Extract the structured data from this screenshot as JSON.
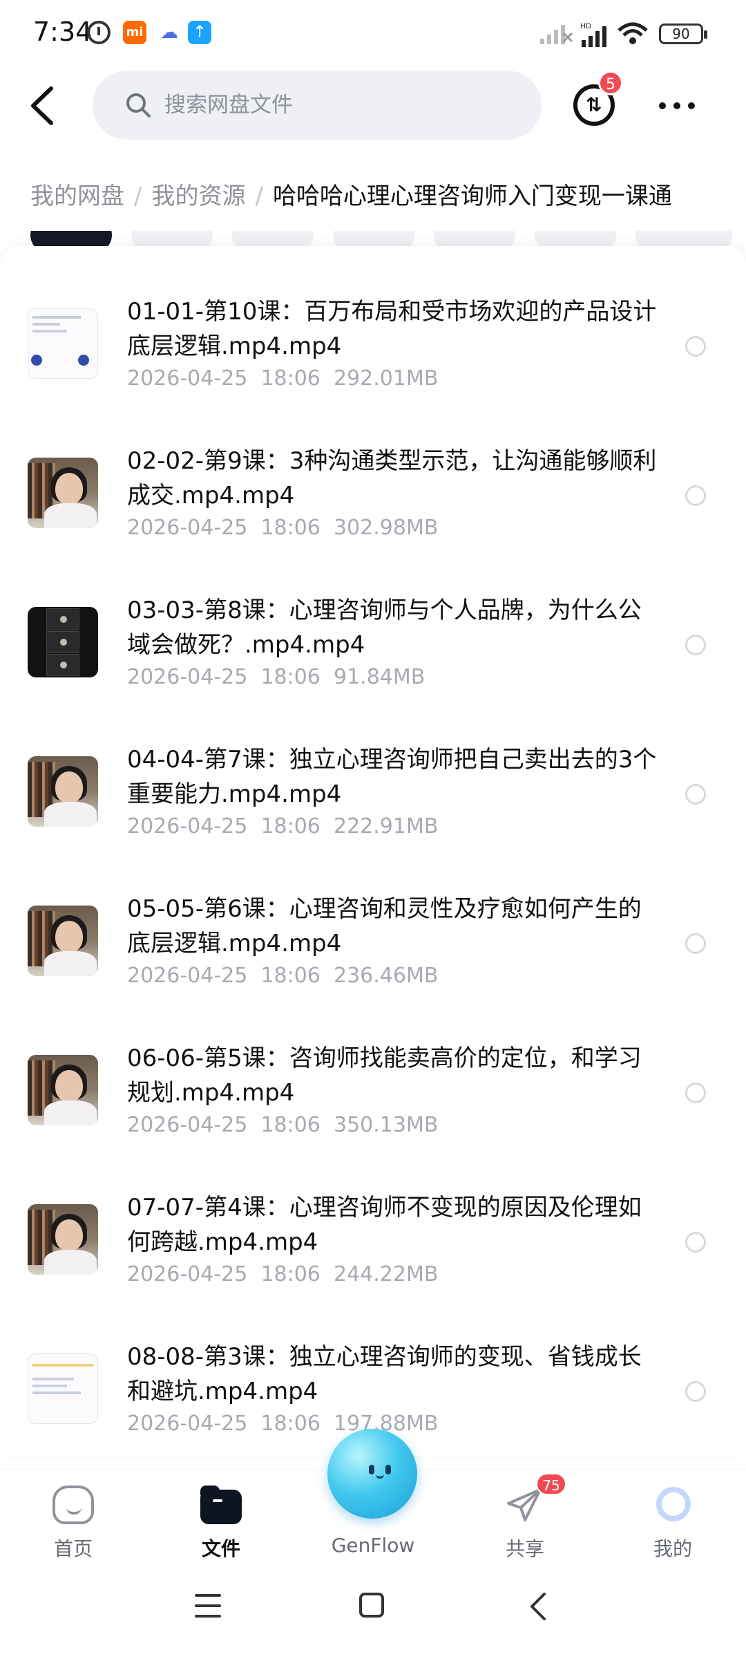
{
  "status_bar": {
    "time": "7:34",
    "mi_icon_text": "mi",
    "network_label": "HD",
    "battery": "90"
  },
  "header": {
    "search_placeholder": "搜索网盘文件",
    "transfer_badge": "5"
  },
  "breadcrumb": {
    "items": [
      "我的网盘",
      "我的资源"
    ],
    "current": "哈哈哈心理心理咨询师入门变现一课通"
  },
  "files": [
    {
      "title": "01-01-第10课：百万布局和受市场欢迎的产品设计底层逻辑.mp4.mp4",
      "date": "2026-04-25",
      "time": "18:06",
      "size": "292.01MB",
      "thumb": "slide"
    },
    {
      "title": "02-02-第9课：3种沟通类型示范，让沟通能够顺利成交.mp4.mp4",
      "date": "2026-04-25",
      "time": "18:06",
      "size": "302.98MB",
      "thumb": "person"
    },
    {
      "title": "03-03-第8课：心理咨询师与个人品牌，为什么公域会做死？.mp4.mp4",
      "date": "2026-04-25",
      "time": "18:06",
      "size": "91.84MB",
      "thumb": "dark"
    },
    {
      "title": "04-04-第7课：独立心理咨询师把自己卖出去的3个重要能力.mp4.mp4",
      "date": "2026-04-25",
      "time": "18:06",
      "size": "222.91MB",
      "thumb": "person"
    },
    {
      "title": "05-05-第6课：心理咨询和灵性及疗愈如何产生的底层逻辑.mp4.mp4",
      "date": "2026-04-25",
      "time": "18:06",
      "size": "236.46MB",
      "thumb": "person"
    },
    {
      "title": "06-06-第5课：咨询师找能卖高价的定位，和学习规划.mp4.mp4",
      "date": "2026-04-25",
      "time": "18:06",
      "size": "350.13MB",
      "thumb": "person"
    },
    {
      "title": "07-07-第4课：心理咨询师不变现的原因及伦理如何跨越.mp4.mp4",
      "date": "2026-04-25",
      "time": "18:06",
      "size": "244.22MB",
      "thumb": "person"
    },
    {
      "title": "08-08-第3课：独立心理咨询师的变现、省钱成长和避坑.mp4.mp4",
      "date": "2026-04-25",
      "time": "18:06",
      "size": "197.88MB",
      "thumb": "slide"
    }
  ],
  "bottom_nav": {
    "items": [
      {
        "label": "首页",
        "icon": "home-icon"
      },
      {
        "label": "文件",
        "icon": "folder-icon",
        "active": true
      },
      {
        "label": "GenFlow",
        "icon": "genflow-orb-icon"
      },
      {
        "label": "共享",
        "icon": "paper-plane-icon",
        "badge": "75"
      },
      {
        "label": "我的",
        "icon": "profile-icon"
      }
    ]
  },
  "colors": {
    "accent_dark": "#0f1422",
    "badge_red": "#f04b55",
    "meta_gray": "#a6aab1",
    "search_bg": "#eef0f5"
  }
}
